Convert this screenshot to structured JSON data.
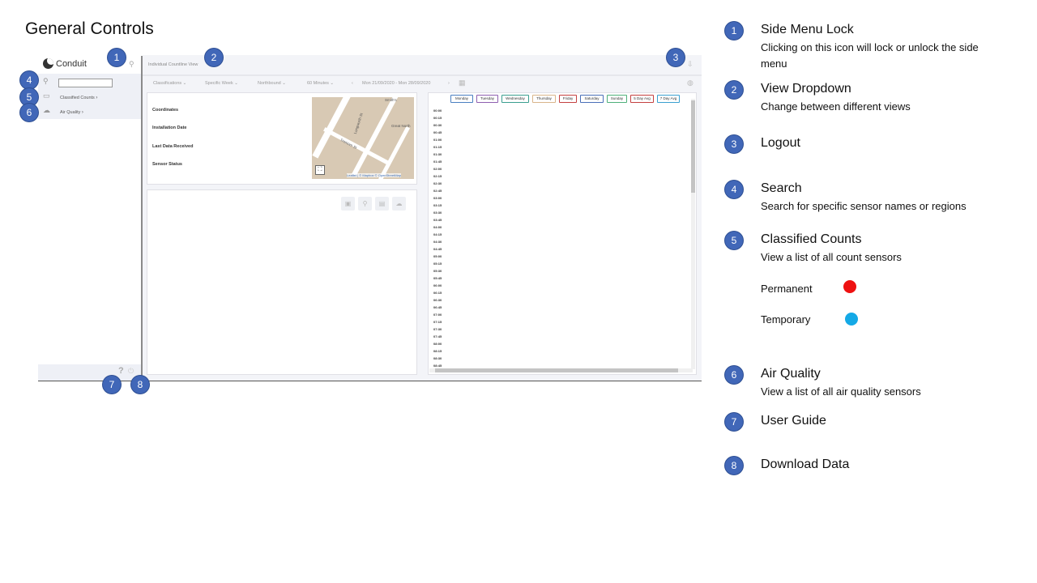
{
  "slide": {
    "title": "General Controls"
  },
  "app": {
    "logo_text": "Conduit",
    "sidebar": {
      "items": [
        {
          "label": "Classified Counts",
          "arrow": "›"
        },
        {
          "label": "Air Quality",
          "arrow": "›"
        }
      ],
      "help_glyph": "?"
    },
    "header": {
      "view_label": "Individual Countline View"
    },
    "filters": [
      "Classifications",
      "Specific Week",
      "Northbound",
      "60 Minutes"
    ],
    "date_range": "Mon 21/09/2020 - Mon 28/09/2020",
    "info_labels": [
      "Coordinates",
      "Installation Date",
      "Last Data Received",
      "Sensor Status"
    ],
    "map": {
      "attribution": "Leaflet | © Mapbox © OpenStreetMap",
      "labels": [
        "Longworth St",
        "Tremorn St",
        "Great North",
        "Smith's"
      ]
    },
    "day_buttons": [
      {
        "label": "Monday",
        "color": "#4a7fc1"
      },
      {
        "label": "Tuesday",
        "color": "#8e5fb0"
      },
      {
        "label": "Wednesday",
        "color": "#3a9e8f"
      },
      {
        "label": "Thursday",
        "color": "#d9b58a"
      },
      {
        "label": "Friday",
        "color": "#c44040"
      },
      {
        "label": "Saturday",
        "color": "#4a6fb8"
      },
      {
        "label": "Sunday",
        "color": "#4eb07a"
      },
      {
        "label": "5 Day Avg",
        "color": "#c44040"
      },
      {
        "label": "7 Day Avg",
        "color": "#3aa0d0"
      }
    ],
    "times": [
      "00:00",
      "00:15",
      "00:30",
      "00:45",
      "01:00",
      "01:15",
      "01:30",
      "01:45",
      "02:00",
      "02:15",
      "02:30",
      "02:45",
      "03:00",
      "03:15",
      "03:30",
      "03:45",
      "04:00",
      "04:15",
      "04:30",
      "04:45",
      "05:00",
      "05:15",
      "05:30",
      "05:45",
      "06:00",
      "06:15",
      "06:30",
      "06:45",
      "07:00",
      "07:15",
      "07:30",
      "07:45",
      "08:00",
      "08:15",
      "08:30",
      "08:45"
    ]
  },
  "legend": [
    {
      "num": "1",
      "title": "Side Menu Lock",
      "desc": "Clicking on this icon will lock or unlock the side menu"
    },
    {
      "num": "2",
      "title": "View Dropdown",
      "desc": "Change between different views"
    },
    {
      "num": "3",
      "title": "Logout",
      "desc": ""
    },
    {
      "num": "4",
      "title": "Search",
      "desc": "Search for specific sensor names or regions"
    },
    {
      "num": "5",
      "title": "Classified Counts",
      "desc": "View a list of all count sensors"
    },
    {
      "num": "6",
      "title": "Air Quality",
      "desc": "View a list of all air quality sensors"
    },
    {
      "num": "7",
      "title": "User Guide",
      "desc": ""
    },
    {
      "num": "8",
      "title": "Download Data",
      "desc": ""
    }
  ],
  "sensor_types": [
    {
      "label": "Permanent",
      "color": "#ee1111"
    },
    {
      "label": "Temporary",
      "color": "#14a9e6"
    }
  ],
  "badges": [
    "1",
    "2",
    "3",
    "4",
    "5",
    "6",
    "7",
    "8"
  ]
}
